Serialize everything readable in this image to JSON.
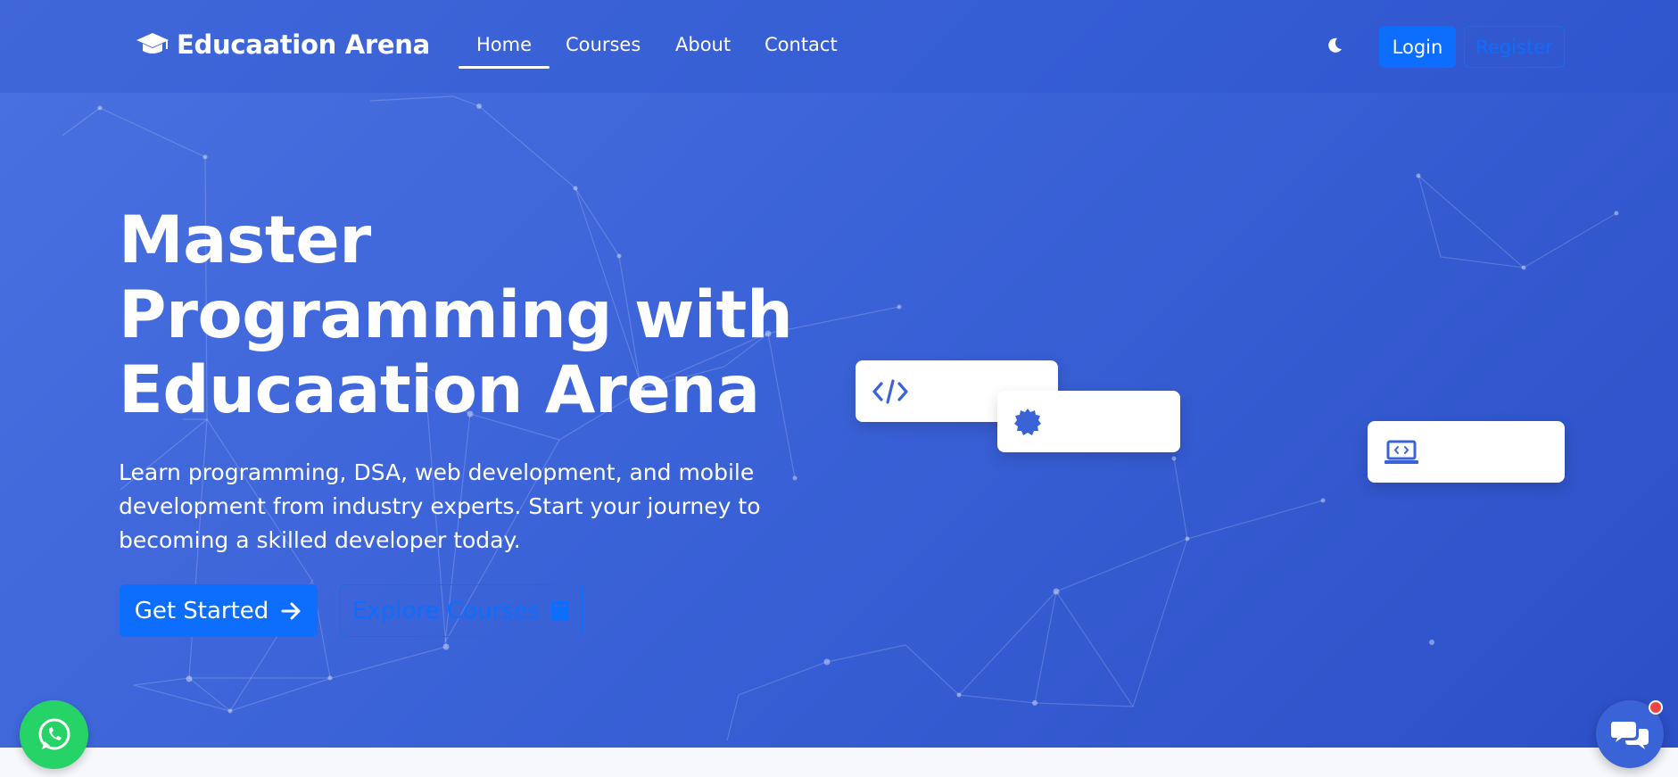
{
  "brand": {
    "name": "Educaation Arena",
    "icon": "graduation-cap-icon"
  },
  "nav": {
    "links": [
      {
        "label": "Home",
        "active": true
      },
      {
        "label": "Courses",
        "active": false
      },
      {
        "label": "About",
        "active": false
      },
      {
        "label": "Contact",
        "active": false
      }
    ],
    "theme_toggle_icon": "moon-icon",
    "login_label": "Login",
    "register_label": "Register"
  },
  "hero": {
    "title": "Master Programming with Educaation Arena",
    "subtitle": "Learn programming, DSA, web development, and mobile development from industry experts. Start your journey to becoming a skilled developer today.",
    "primary_button": {
      "label": "Get Started",
      "icon": "arrow-right-icon"
    },
    "secondary_button": {
      "label": "Explore Courses",
      "icon": "book-icon"
    }
  },
  "floating_cards": [
    {
      "icon": "code-icon"
    },
    {
      "icon": "certificate-icon"
    },
    {
      "icon": "laptop-code-icon"
    }
  ],
  "widgets": {
    "whatsapp_icon": "whatsapp-icon",
    "chat_icon": "chat-bubbles-icon",
    "chat_has_notification": true
  },
  "colors": {
    "hero_gradient_start": "#4a71e0",
    "hero_gradient_end": "#2c4fc7",
    "primary": "#0d6efd",
    "whatsapp": "#25d366",
    "notification": "#ef4444"
  }
}
